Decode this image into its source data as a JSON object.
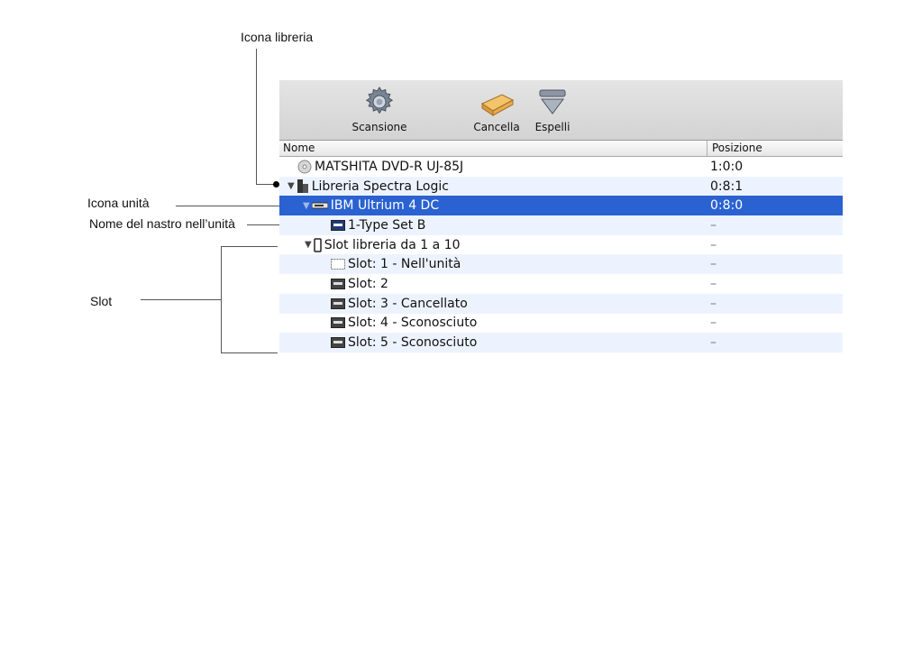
{
  "callouts": {
    "library_icon": "Icona libreria",
    "drive_icon": "Icona unità",
    "tape_name": "Nome del nastro nell’unità",
    "slot": "Slot"
  },
  "toolbar": {
    "scan_label": "Scansione",
    "erase_label": "Cancella",
    "eject_label": "Espelli"
  },
  "columns": {
    "name": "Nome",
    "position": "Posizione"
  },
  "rows": [
    {
      "name": "MATSHITA DVD-R   UJ-85J",
      "position": "1:0:0",
      "icon": "disc-icon"
    },
    {
      "name": "Libreria Spectra Logic",
      "position": "0:8:1",
      "icon": "library-icon"
    },
    {
      "name": "IBM Ultrium 4 DC",
      "position": "0:8:0",
      "icon": "tape-drive-icon"
    },
    {
      "name": "1-Type Set B",
      "position": "–",
      "icon": "tape-cartridge-icon"
    },
    {
      "name": "Slot libreria da 1 a 10",
      "position": "–",
      "icon": "slot-group-icon"
    },
    {
      "name": "Slot: 1 - Nell'unità",
      "position": "–",
      "icon": "empty-slot-icon"
    },
    {
      "name": "Slot: 2",
      "position": "–",
      "icon": "tape-cartridge-icon"
    },
    {
      "name": "Slot: 3 - Cancellato",
      "position": "–",
      "icon": "tape-cartridge-icon"
    },
    {
      "name": "Slot: 4 - Sconosciuto",
      "position": "–",
      "icon": "tape-cartridge-icon"
    },
    {
      "name": "Slot: 5 - Sconosciuto",
      "position": "–",
      "icon": "tape-cartridge-icon"
    }
  ],
  "colors": {
    "selection": "#2b62d1",
    "alt_row": "#edf3fe",
    "toolbar": "#dcdcdc"
  }
}
